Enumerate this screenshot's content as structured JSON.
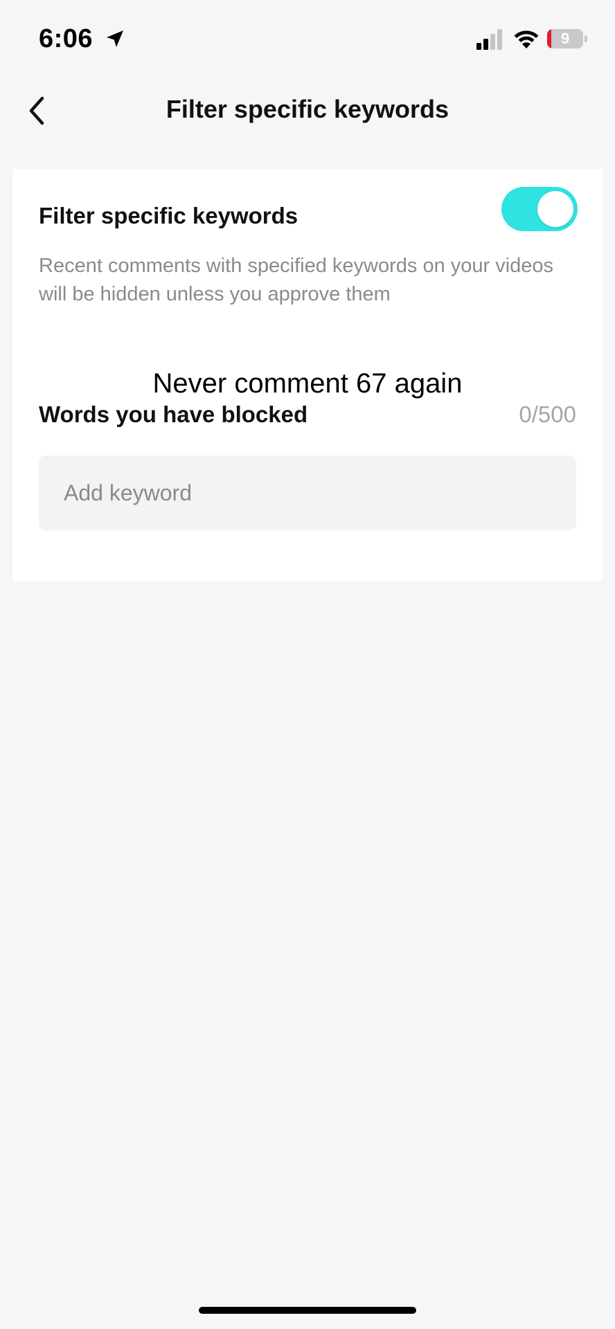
{
  "status_bar": {
    "time": "6:06",
    "battery_level": "9",
    "icons": [
      "location-arrow-icon",
      "cellular-signal-icon",
      "wifi-icon",
      "battery-icon"
    ]
  },
  "header": {
    "back_icon": "chevron-left-icon",
    "title": "Filter specific keywords"
  },
  "filter_setting": {
    "title": "Filter specific keywords",
    "enabled": true,
    "toggle_color": "#2ee3e0",
    "description": "Recent comments with specified keywords on your videos will be hidden unless you approve them"
  },
  "overlay_caption": "Never comment 67 again",
  "blocked_words": {
    "label": "Words you have blocked",
    "count": "0/500",
    "input_placeholder": "Add keyword",
    "input_value": ""
  }
}
